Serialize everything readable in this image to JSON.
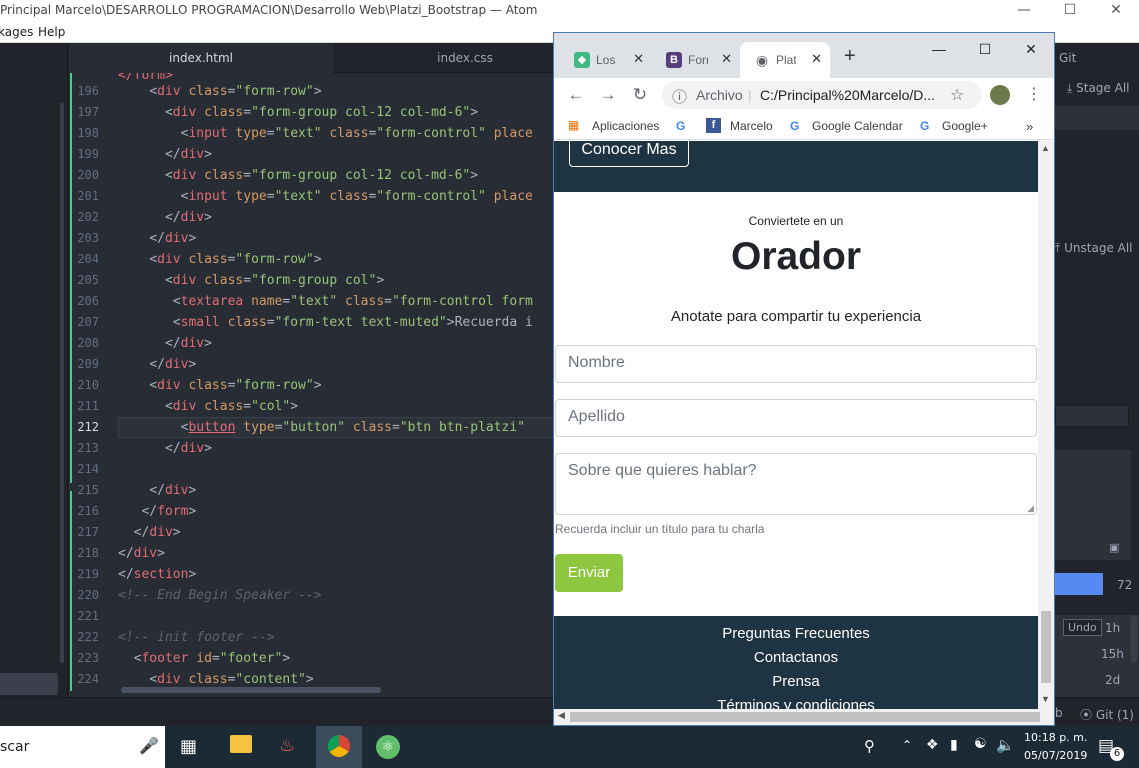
{
  "atom": {
    "title": "Principal Marcelo\\DESARROLLO PROGRAMACION\\Desarrollo Web\\Platzi_Bootstrap — Atom",
    "menu": [
      "kages",
      "Help"
    ],
    "tabs": [
      "index.html",
      "index.css"
    ],
    "gutter_lines": [
      "196",
      "197",
      "198",
      "199",
      "200",
      "201",
      "202",
      "203",
      "204",
      "205",
      "206",
      "207",
      "208",
      "209",
      "210",
      "211",
      "212",
      "213",
      "214",
      "215",
      "216",
      "217",
      "218",
      "219",
      "220",
      "221",
      "222",
      "223",
      "224"
    ],
    "current_line": "212"
  },
  "git_panel": {
    "title": "Git",
    "stage_all": "Stage All",
    "unstage_all": "Unstage All",
    "count": "72",
    "undo": "Undo",
    "times": [
      "1h",
      "15h",
      "2d"
    ],
    "status_git": "Git (1)",
    "status_b": "b"
  },
  "chrome": {
    "tabs": [
      {
        "label": "Los f",
        "icon": "vue-icon",
        "color": "#41b883"
      },
      {
        "label": "Form",
        "icon": "bootstrap-icon",
        "color": "#563d7c"
      },
      {
        "label": "Platz",
        "icon": "globe-icon",
        "color": "#5f6368"
      }
    ],
    "new_tab": "+",
    "address_prefix": "Archivo",
    "address": "C:/Principal%20Marcelo/D...",
    "bookmarks": [
      "Aplicaciones",
      "Marcelo",
      "Google Calendar",
      "Google+"
    ],
    "bookmarks_more": "»"
  },
  "page": {
    "hero_button": "Conocer Mas",
    "kicker": "Conviertete en un",
    "heading": "Orador",
    "lead": "Anotate para compartir tu experiencia",
    "fields": {
      "nombre": "Nombre",
      "apellido": "Apellido",
      "tema": "Sobre que quieres hablar?"
    },
    "help_text": "Recuerda incluir un título para tu charla",
    "submit": "Enviar",
    "footer_links": [
      "Preguntas Frecuentes",
      "Contactanos",
      "Prensa",
      "Términos y condiciones"
    ]
  },
  "taskbar": {
    "search": "scar",
    "time": "10:18 p. m.",
    "date": "05/07/2019",
    "notifications": "6"
  },
  "colors": {
    "accent_green": "#8dc63f",
    "dark_navy": "#1f3442",
    "editor_bg": "#282c34"
  }
}
